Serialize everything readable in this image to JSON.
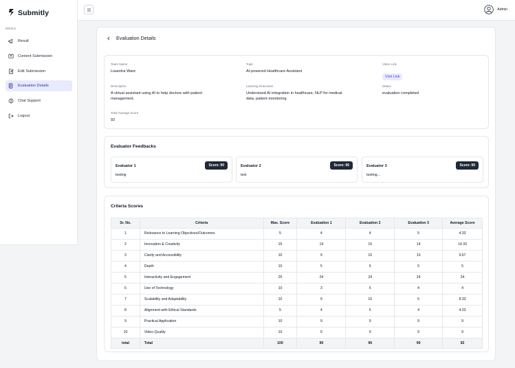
{
  "brand": {
    "name": "Submitly"
  },
  "sidebar": {
    "menu_label": "MENU",
    "items": [
      {
        "label": "Result",
        "icon": "megaphone-icon"
      },
      {
        "label": "Content Submission",
        "icon": "upload-icon"
      },
      {
        "label": "Edit Submission",
        "icon": "edit-icon"
      },
      {
        "label": "Evaluation Details",
        "icon": "evaluation-icon",
        "active": true
      },
      {
        "label": "Chat Support",
        "icon": "chat-icon"
      },
      {
        "label": "Logout",
        "icon": "logout-icon"
      }
    ]
  },
  "topbar": {
    "user": "Admin"
  },
  "page": {
    "title": "Evaluation Details"
  },
  "info": {
    "team_name_label": "Team Name",
    "team_name": "Lisandra Ware",
    "topic_label": "Topic",
    "topic": "AI-powered Healthcare Assistant",
    "video_link_label": "Video Link",
    "video_link_text": "Visit Link",
    "description_label": "Description",
    "description": "A virtual assistant using AI to help doctors with patient management.",
    "outcomes_label": "Learning Outcomes",
    "outcomes": "Understand AI integration in healthcare, NLP for medical data, patient monitoring.",
    "status_label": "Status",
    "status": "evaluation completed",
    "total_label": "Total Average Score",
    "total": "92"
  },
  "feedback": {
    "title": "Evaluator Feedbacks",
    "evaluators": [
      {
        "name": "Evaluator 1",
        "score": "Score: 90",
        "text": "testing"
      },
      {
        "name": "Evaluator 2",
        "score": "Score: 96",
        "text": "test"
      },
      {
        "name": "Evaluator 3",
        "score": "Score: 90",
        "text": "testing..."
      }
    ]
  },
  "criteria": {
    "title": "Criteria Scores",
    "headers": [
      "Sr. No.",
      "Criteria",
      "Max. Score",
      "Evaluation 1",
      "Evaluation 2",
      "Evaluation 3",
      "Average Score"
    ],
    "rows": [
      [
        "1",
        "Relevance to Learning Objectives/Outcomes",
        "5",
        "4",
        "4",
        "5",
        "4.33"
      ],
      [
        "2",
        "Innovation & Creativity",
        "15",
        "14",
        "15",
        "14",
        "14.33"
      ],
      [
        "3",
        "Clarity and Accessibility",
        "10",
        "9",
        "10",
        "10",
        "9.67"
      ],
      [
        "4",
        "Depth",
        "10",
        "5",
        "5",
        "5",
        "5"
      ],
      [
        "5",
        "Interactivity and Engagement",
        "25",
        "24",
        "24",
        "24",
        "24"
      ],
      [
        "6",
        "Use of Technology",
        "10",
        "3",
        "5",
        "4",
        "4"
      ],
      [
        "7",
        "Scalability and Adaptability",
        "10",
        "9",
        "10",
        "6",
        "8.33"
      ],
      [
        "8",
        "Alignment with Ethical Standards",
        "5",
        "4",
        "5",
        "4",
        "4.33"
      ],
      [
        "9",
        "Practical Application",
        "10",
        "9",
        "9",
        "9",
        "9"
      ],
      [
        "10",
        "Video Quality",
        "10",
        "9",
        "9",
        "9",
        "9"
      ]
    ],
    "total": [
      "total",
      "Total",
      "100",
      "90",
      "96",
      "90",
      "92"
    ]
  }
}
